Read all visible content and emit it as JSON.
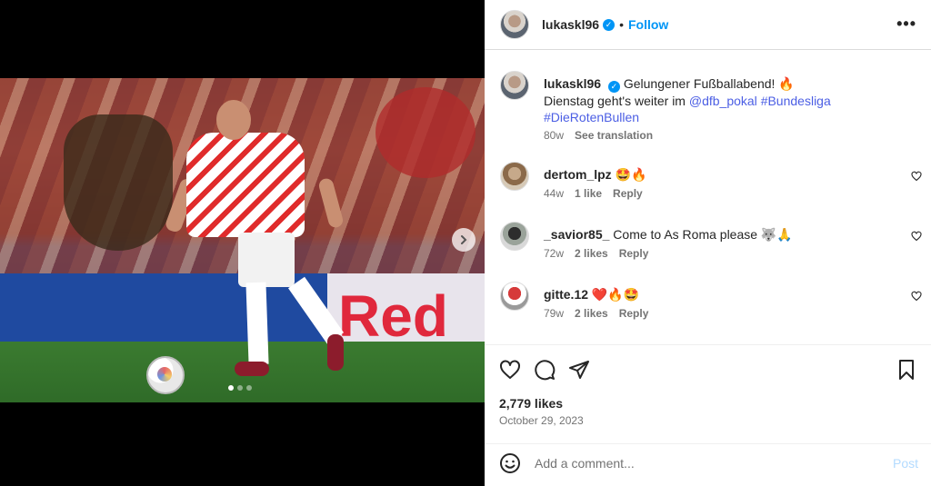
{
  "post": {
    "username": "lukaskl96",
    "follow_label": "Follow",
    "separator": "•",
    "more_label": "•••",
    "caption_line1": "Gelungener Fußballabend! 🔥",
    "caption_line2_prefix": "Dienstag geht's weiter im ",
    "mention": "@dfb_pokal",
    "hashtag1": "#Bundesliga",
    "hashtag2": "#DieRotenBullen",
    "caption_age": "80w",
    "see_translation": "See translation"
  },
  "comments": [
    {
      "user": "dertom_lpz",
      "text": "🤩🔥",
      "age": "44w",
      "likes": "1 like",
      "reply": "Reply"
    },
    {
      "user": "_savior85_",
      "text": "Come to As Roma please 🐺🙏",
      "age": "72w",
      "likes": "2 likes",
      "reply": "Reply"
    },
    {
      "user": "gitte.12",
      "text": "❤️🔥🤩",
      "age": "79w",
      "likes": "2 likes",
      "reply": "Reply"
    }
  ],
  "media": {
    "board_text": "Red",
    "carousel_count": 3,
    "carousel_active": 0
  },
  "footer": {
    "likes": "2,779 likes",
    "date": "October 29, 2023",
    "comment_placeholder": "Add a comment...",
    "post_label": "Post"
  },
  "colors": {
    "accent": "#0095f6",
    "text": "#262626",
    "muted": "#737373",
    "hashtag": "#4b5ee4",
    "post_disabled": "#b3dbff"
  },
  "icons": [
    "more-icon",
    "verified-icon",
    "heart-icon",
    "comment-icon",
    "share-icon",
    "save-icon",
    "emoji-icon",
    "chevron-right-icon"
  ]
}
